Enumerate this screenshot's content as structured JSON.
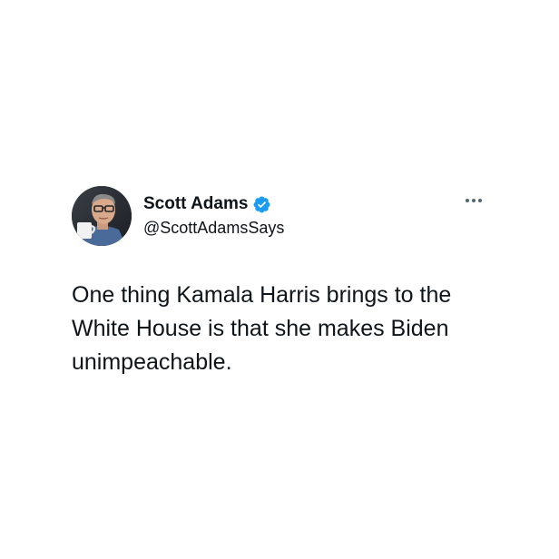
{
  "tweet": {
    "author_name": "Scott Adams",
    "author_handle": "@ScottAdamsSays",
    "text": "One thing Kamala Harris brings to the White House is that she makes Biden unimpeachable.",
    "verified_icon": "verified-badge-icon",
    "more_icon": "more-options-icon"
  },
  "colors": {
    "verified_blue": "#1d9bf0",
    "text_primary": "#0f1419",
    "icon_gray": "#536471"
  }
}
